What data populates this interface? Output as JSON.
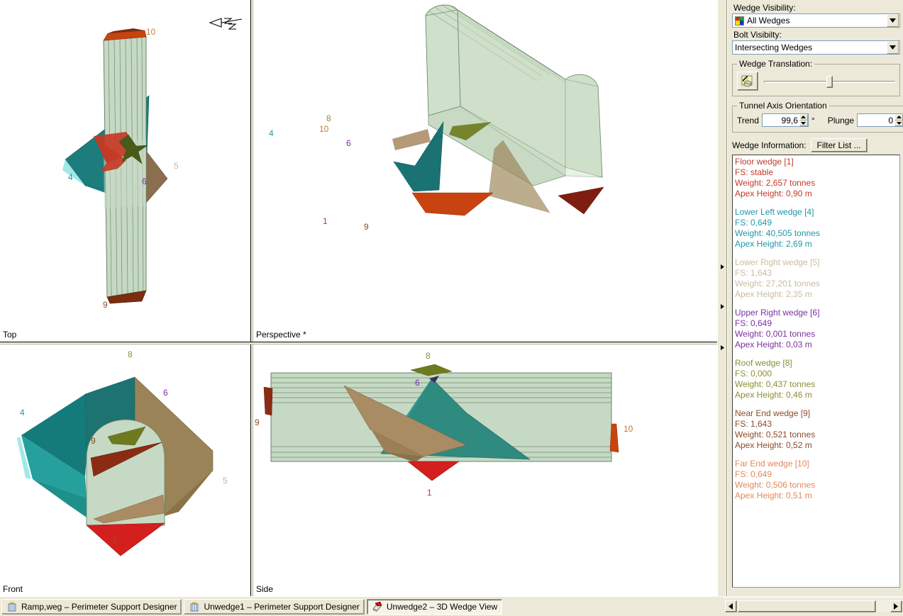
{
  "viewports": [
    {
      "name": "top",
      "label": "Top"
    },
    {
      "name": "perspective",
      "label": "Perspective *"
    },
    {
      "name": "front",
      "label": "Front"
    },
    {
      "name": "side",
      "label": "Side"
    }
  ],
  "panel": {
    "wedge_visibility_label": "Wedge Visibility:",
    "wedge_visibility_value": "All Wedges",
    "bolt_visibility_label": "Bolt Visibilty:",
    "bolt_visibility_value": "Intersecting Wedges",
    "wedge_translation_legend": "Wedge Translation:",
    "translation_slider_percent": 50,
    "tunnel_axis_legend": "Tunnel Axis Orientation",
    "trend_label": "Trend",
    "trend_value": "99,6",
    "degree_symbol": "°",
    "plunge_label": "Plunge",
    "plunge_value": "0",
    "wedge_information_label": "Wedge Information:",
    "filter_list_label": "Filter List ..."
  },
  "wedges": [
    {
      "name": "Floor wedge [1]",
      "fs": "FS: stable",
      "weight": "Weight: 2,657 tonnes",
      "apex": "Apex Height: 0,90 m",
      "color": "#e8453c",
      "id": 1,
      "label_color": "#c0392b"
    },
    {
      "name": "Lower Left wedge [4]",
      "fs": "FS: 0,649",
      "weight": "Weight: 40,505 tonnes",
      "apex": "Apex Height: 2,69 m",
      "color": "#1d7d7d",
      "id": 4,
      "label_color": "#2196a8"
    },
    {
      "name": "Lower Right wedge [5]",
      "fs": "FS: 1,643",
      "weight": "Weight: 27,201 tonnes",
      "apex": "Apex Height: 2,35 m",
      "color": "#b4a078",
      "id": 5,
      "label_color": "#c9bd9e"
    },
    {
      "name": "Upper Right wedge [6]",
      "fs": "FS: 0,649",
      "weight": "Weight: 0,001 tonnes",
      "apex": "Apex Height: 0,03 m",
      "color": "#7a3f9d",
      "id": 6,
      "label_color": "#7b2fa0"
    },
    {
      "name": "Roof wedge [8]",
      "fs": "FS: 0,000",
      "weight": "Weight: 0,437 tonnes",
      "apex": "Apex Height: 0,46 m",
      "color": "#6e7a1e",
      "id": 8,
      "label_color": "#8a8f36"
    },
    {
      "name": "Near End wedge [9]",
      "fs": "FS: 1,643",
      "weight": "Weight: 0,521 tonnes",
      "apex": "Apex Height: 0,52 m",
      "color": "#8c2b13",
      "id": 9,
      "label_color": "#8a4b2a"
    },
    {
      "name": "Far End wedge [10]",
      "fs": "FS: 0,649",
      "weight": "Weight: 0,506 tonnes",
      "apex": "Apex Height: 0,51 m",
      "color": "#d8561f",
      "id": 10,
      "label_color": "#e08a5a"
    }
  ],
  "taskbar": [
    {
      "label": "Ramp,weg – Perimeter Support Designer",
      "active": false,
      "icon": "unwedge-icon"
    },
    {
      "label": "Unwedge1 – Perimeter Support Designer",
      "active": false,
      "icon": "unwedge-icon"
    },
    {
      "label": "Unwedge2 – 3D Wedge View",
      "active": true,
      "icon": "wedge-view-icon"
    }
  ],
  "colors": {
    "tunnel_fill": "#c6d9c4",
    "tunnel_line": "#5a7a5a",
    "panel_bg": "#ece9d8",
    "viewport_bg": "#ffffff",
    "teal": "#1d7d7d",
    "teal_light": "#2aa09c",
    "tan": "#a98c63",
    "tan_light": "#b9a177",
    "red": "#d41f1f",
    "dark_red": "#8c2b13",
    "orange": "#c8430f",
    "olive": "#6e7a1e"
  },
  "view_labels": {
    "top": [
      "10",
      "4",
      "5",
      "6",
      "9"
    ],
    "perspective": [
      "8",
      "6",
      "1",
      "9"
    ],
    "front": [
      "8",
      "4",
      "6",
      "9",
      "5",
      "1"
    ],
    "side": [
      "8",
      "6",
      "9",
      "10",
      "1"
    ]
  }
}
